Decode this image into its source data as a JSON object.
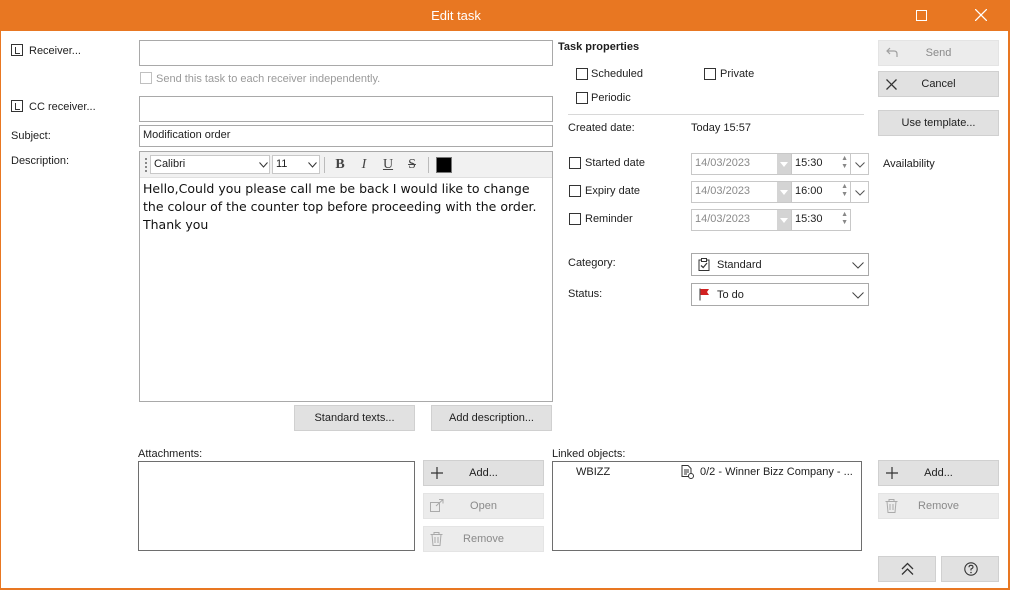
{
  "window": {
    "title": "Edit task"
  },
  "receiver": {
    "label": "Receiver...",
    "value": ""
  },
  "send_independently": {
    "label": "Send this task to each receiver independently."
  },
  "cc_receiver": {
    "label": "CC receiver...",
    "value": ""
  },
  "subject": {
    "label": "Subject:",
    "value": "Modification order"
  },
  "description": {
    "label": "Description:",
    "font": "Calibri",
    "size": "11",
    "text": "Hello,Could you please call me be back I would like to change the colour of the counter top before proceeding with the order.\nThank you",
    "color": "#000000"
  },
  "buttons": {
    "standard_texts": "Standard texts...",
    "add_description": "Add description...",
    "send": "Send",
    "cancel": "Cancel",
    "use_template": "Use template...",
    "add": "Add...",
    "open": "Open",
    "remove": "Remove"
  },
  "task_properties": {
    "heading": "Task properties",
    "scheduled": "Scheduled",
    "private": "Private",
    "periodic": "Periodic",
    "created_label": "Created date:",
    "created_value": "Today 15:57",
    "started": {
      "label": "Started date",
      "date": "14/03/2023",
      "time": "15:30"
    },
    "expiry": {
      "label": "Expiry date",
      "date": "14/03/2023",
      "time": "16:00"
    },
    "reminder": {
      "label": "Reminder",
      "date": "14/03/2023",
      "time": "15:30"
    },
    "availability": "Availability",
    "category_label": "Category:",
    "category_value": "Standard",
    "status_label": "Status:",
    "status_value": "To do"
  },
  "attachments": {
    "label": "Attachments:"
  },
  "linked": {
    "label": "Linked objects:",
    "rows": [
      {
        "name": "WBIZZ",
        "detail": "0/2 - Winner Bizz Company - ..."
      }
    ]
  },
  "colors": {
    "accent": "#e87722",
    "availability": "#c8642a",
    "flag": "#d12020"
  }
}
